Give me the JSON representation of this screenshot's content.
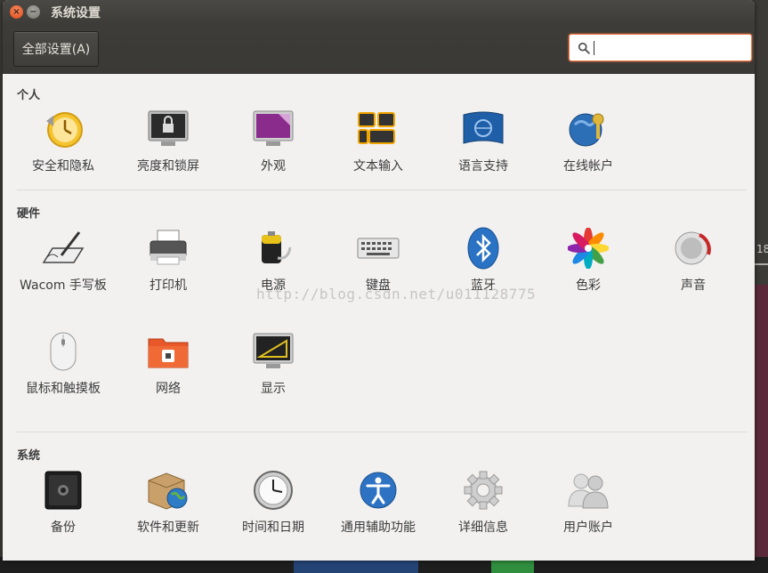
{
  "window": {
    "title": "系统设置"
  },
  "toolbar": {
    "all_settings_label": "全部设置(A)",
    "search_value": "",
    "search_placeholder": ""
  },
  "sections": {
    "personal": {
      "title": "个人",
      "items": [
        {
          "label": "安全和隐私",
          "icon": "security-privacy-icon"
        },
        {
          "label": "亮度和锁屏",
          "icon": "brightness-lock-icon"
        },
        {
          "label": "外观",
          "icon": "appearance-icon"
        },
        {
          "label": "文本输入",
          "icon": "text-entry-icon"
        },
        {
          "label": "语言支持",
          "icon": "language-support-icon"
        },
        {
          "label": "在线帐户",
          "icon": "online-accounts-icon"
        }
      ]
    },
    "hardware": {
      "title": "硬件",
      "items": [
        {
          "label": "Wacom 手写板",
          "icon": "wacom-tablet-icon"
        },
        {
          "label": "打印机",
          "icon": "printer-icon"
        },
        {
          "label": "电源",
          "icon": "power-icon"
        },
        {
          "label": "键盘",
          "icon": "keyboard-icon"
        },
        {
          "label": "蓝牙",
          "icon": "bluetooth-icon"
        },
        {
          "label": "色彩",
          "icon": "color-icon"
        },
        {
          "label": "声音",
          "icon": "sound-icon"
        },
        {
          "label": "鼠标和触摸板",
          "icon": "mouse-touchpad-icon"
        },
        {
          "label": "网络",
          "icon": "network-icon"
        },
        {
          "label": "显示",
          "icon": "display-icon"
        }
      ]
    },
    "system": {
      "title": "系统",
      "items": [
        {
          "label": "备份",
          "icon": "backup-icon"
        },
        {
          "label": "软件和更新",
          "icon": "software-updates-icon"
        },
        {
          "label": "时间和日期",
          "icon": "time-date-icon"
        },
        {
          "label": "通用辅助功能",
          "icon": "universal-access-icon"
        },
        {
          "label": "详细信息",
          "icon": "details-icon"
        },
        {
          "label": "用户账户",
          "icon": "user-accounts-icon"
        }
      ]
    }
  },
  "watermark": "http://blog.csdn.net/u011128775",
  "desktop": {
    "right_edge_text": "18"
  },
  "colors": {
    "accent": "#f07746",
    "titlebar": "#3c3b37",
    "content_bg": "#f2f1f0"
  }
}
